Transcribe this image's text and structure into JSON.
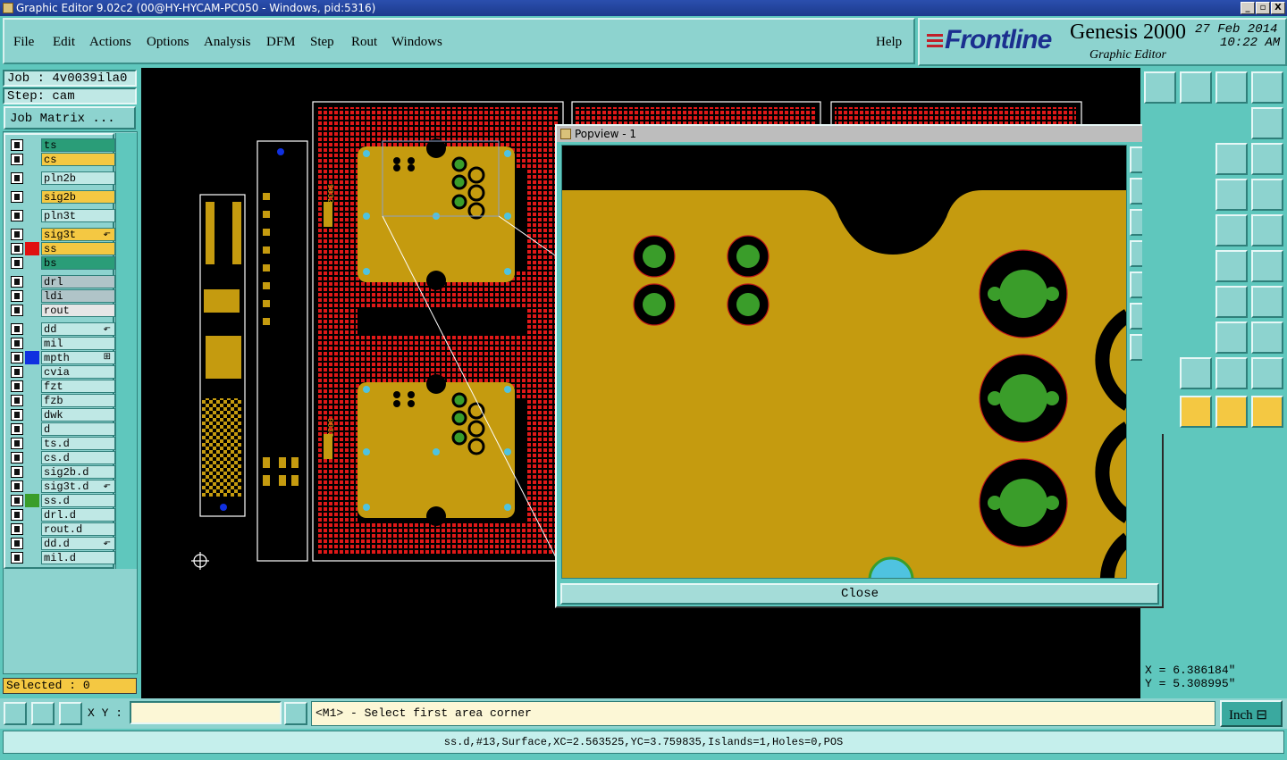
{
  "window": {
    "title": "Graphic Editor 9.02c2 (00@HY-HYCAM-PC050 - Windows, pid:5316)",
    "controls": [
      "_",
      "▫",
      "X"
    ]
  },
  "menu": [
    {
      "label": "File"
    },
    {
      "label": "Edit"
    },
    {
      "label": "Actions"
    },
    {
      "label": "Options"
    },
    {
      "label": "Analysis"
    },
    {
      "label": "DFM"
    },
    {
      "label": "Step"
    },
    {
      "label": "Rout"
    },
    {
      "label": "Windows"
    }
  ],
  "help_label": "Help",
  "brand": {
    "logo": "Frontline",
    "product": "Genesis 2000",
    "subtitle": "Graphic Editor",
    "date": "27 Feb 2014",
    "time": "10:22 AM"
  },
  "job": {
    "job_line": "Job : 4v0039ila0",
    "step_line": "Step: cam",
    "matrix_button": "Job Matrix ..."
  },
  "layers": [
    {
      "name": "ts",
      "color": "#2a9d78",
      "bg": "#2a9d78"
    },
    {
      "name": "cs",
      "color": "#f4c842",
      "bg": "#f4c842"
    },
    {
      "name": "pln2b",
      "color": "#bfe8e5",
      "bg": "#bfe8e5"
    },
    {
      "name": "sig2b",
      "color": "#f4c842",
      "bg": "#f4c842"
    },
    {
      "name": "pln3t",
      "color": "#bfe8e5",
      "bg": "#bfe8e5"
    },
    {
      "name": "sig3t",
      "color": "#f4c842",
      "bg": "#f4c842",
      "flag": "⬐"
    },
    {
      "name": "ss",
      "color": "#e01010",
      "bg": "#f4c842"
    },
    {
      "name": "bs",
      "color": "#2a9d78",
      "bg": "#2a9d78"
    },
    {
      "name": "drl",
      "color": "#b0c4c8",
      "bg": "#b0c4c8"
    },
    {
      "name": "ldi",
      "color": "#b0c4c8",
      "bg": "#b0c4c8"
    },
    {
      "name": "rout",
      "color": "#e6e6e6",
      "bg": "#e6e6e6"
    },
    {
      "name": "dd",
      "color": "#bfe8e5",
      "bg": "#bfe8e5",
      "flag": "⬐"
    },
    {
      "name": "mil",
      "color": "#bfe8e5",
      "bg": "#bfe8e5"
    },
    {
      "name": "mpth",
      "color": "#1030e0",
      "bg": "#bfe8e5",
      "flag": "⊞"
    },
    {
      "name": "cvia",
      "color": "#bfe8e5",
      "bg": "#bfe8e5"
    },
    {
      "name": "fzt",
      "color": "#bfe8e5",
      "bg": "#bfe8e5"
    },
    {
      "name": "fzb",
      "color": "#bfe8e5",
      "bg": "#bfe8e5"
    },
    {
      "name": "dwk",
      "color": "#bfe8e5",
      "bg": "#bfe8e5"
    },
    {
      "name": "d",
      "color": "#bfe8e5",
      "bg": "#bfe8e5"
    },
    {
      "name": "ts.d",
      "color": "#bfe8e5",
      "bg": "#bfe8e5"
    },
    {
      "name": "cs.d",
      "color": "#bfe8e5",
      "bg": "#bfe8e5"
    },
    {
      "name": "sig2b.d",
      "color": "#bfe8e5",
      "bg": "#bfe8e5"
    },
    {
      "name": "sig3t.d",
      "color": "#bfe8e5",
      "bg": "#bfe8e5",
      "flag": "⬐"
    },
    {
      "name": "ss.d",
      "color": "#3a9d2a",
      "bg": "#bfe8e5"
    },
    {
      "name": "drl.d",
      "color": "#bfe8e5",
      "bg": "#bfe8e5"
    },
    {
      "name": "rout.d",
      "color": "#bfe8e5",
      "bg": "#bfe8e5"
    },
    {
      "name": "dd.d",
      "color": "#bfe8e5",
      "bg": "#bfe8e5",
      "flag": "⬐"
    },
    {
      "name": "mil.d",
      "color": "#bfe8e5",
      "bg": "#bfe8e5"
    }
  ],
  "selected_label": "Selected : 0",
  "popview": {
    "title": "Popview - 1",
    "close_label": "Close"
  },
  "coords": {
    "x": "X = 6.386184\"",
    "y": "Y = 5.308995\""
  },
  "bottom": {
    "xy_label": "X Y :",
    "xy_value": "",
    "prompt": "<M1> - Select first area corner",
    "unit": "Inch"
  },
  "status": "ss.d,#13,Surface,XC=2.563525,YC=3.759835,Islands=1,Holes=0,POS",
  "board_text": {
    "label_a": "9032",
    "label_b": "9032"
  },
  "colors": {
    "copper": "#c59b0f",
    "mask_red": "#e01818",
    "via_cyan": "#4fc3e0",
    "pad_green": "#3a9d2a",
    "panel": "#8dd3cf"
  }
}
